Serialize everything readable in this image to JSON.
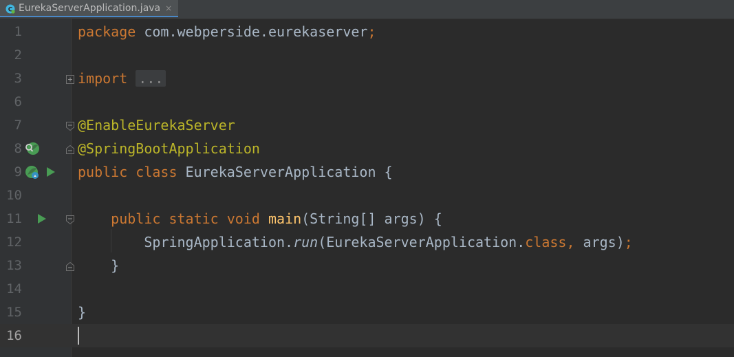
{
  "tab": {
    "label": "EurekaServerApplication.java",
    "close": "×"
  },
  "lines": [
    {
      "num": "1",
      "tokens": [
        {
          "t": "package",
          "c": "kw"
        },
        {
          "t": " com.webperside.eurekaserver",
          "c": ""
        },
        {
          "t": ";",
          "c": "kw"
        }
      ]
    },
    {
      "num": "2",
      "tokens": []
    },
    {
      "num": "3",
      "tokens": [
        {
          "t": "import",
          "c": "kw"
        },
        {
          "t": " ",
          "c": ""
        },
        {
          "t": "...",
          "c": "fold-box"
        }
      ]
    },
    {
      "num": "6",
      "tokens": []
    },
    {
      "num": "7",
      "tokens": [
        {
          "t": "@EnableEurekaServer",
          "c": "ann"
        }
      ]
    },
    {
      "num": "8",
      "tokens": [
        {
          "t": "@SpringBootApplication",
          "c": "ann"
        }
      ]
    },
    {
      "num": "9",
      "tokens": [
        {
          "t": "public class",
          "c": "kw"
        },
        {
          "t": " EurekaServerApplication {",
          "c": ""
        }
      ]
    },
    {
      "num": "10",
      "tokens": []
    },
    {
      "num": "11",
      "tokens": [
        {
          "t": "    ",
          "c": ""
        },
        {
          "t": "public static void",
          "c": "kw"
        },
        {
          "t": " ",
          "c": ""
        },
        {
          "t": "main",
          "c": "fn"
        },
        {
          "t": "(String[] args) {",
          "c": ""
        }
      ]
    },
    {
      "num": "12",
      "tokens": [
        {
          "t": "        SpringApplication.",
          "c": ""
        },
        {
          "t": "run",
          "c": "it"
        },
        {
          "t": "(EurekaServerApplication.",
          "c": ""
        },
        {
          "t": "class,",
          "c": "kw"
        },
        {
          "t": " args)",
          "c": ""
        },
        {
          "t": ";",
          "c": "kw"
        }
      ]
    },
    {
      "num": "13",
      "tokens": [
        {
          "t": "    }",
          "c": ""
        }
      ]
    },
    {
      "num": "14",
      "tokens": []
    },
    {
      "num": "15",
      "tokens": [
        {
          "t": "}",
          "c": ""
        }
      ]
    },
    {
      "num": "16",
      "tokens": []
    }
  ],
  "colors": {
    "background": "#2b2b2b",
    "keyword": "#cc7832",
    "annotation": "#bbb529",
    "method": "#ffc66d",
    "text": "#a9b7c6",
    "gutter": "#313335",
    "run_icon": "#499c54"
  },
  "gutter_icons": {
    "line8": [
      "spring-bean-search-icon"
    ],
    "line9": [
      "spring-bean-icon",
      "run-icon"
    ],
    "line11": [
      "run-icon"
    ]
  }
}
